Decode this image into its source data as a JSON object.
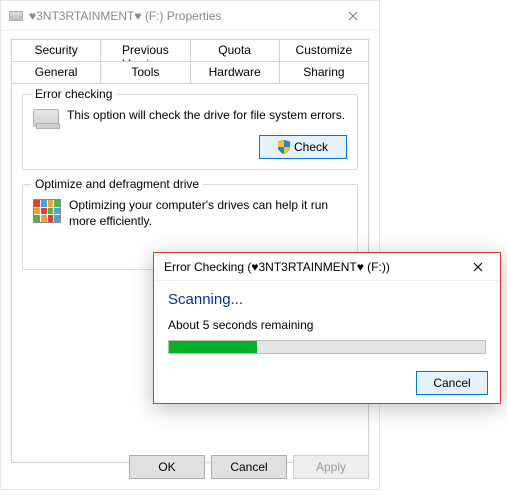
{
  "window": {
    "title": "♥3NT3RTAINMENT♥ (F:) Properties"
  },
  "tabs": {
    "row1": {
      "security": "Security",
      "previous_versions": "Previous Versions",
      "quota": "Quota",
      "customize": "Customize"
    },
    "row2": {
      "general": "General",
      "tools": "Tools",
      "hardware": "Hardware",
      "sharing": "Sharing"
    },
    "active": "tools"
  },
  "error_check_group": {
    "title": "Error checking",
    "desc": "This option will check the drive for file system errors.",
    "button": "Check"
  },
  "defrag_group": {
    "title": "Optimize and defragment drive",
    "desc": "Optimizing your computer's drives can help it run more efficiently."
  },
  "buttons": {
    "ok": "OK",
    "cancel": "Cancel",
    "apply": "Apply"
  },
  "modal": {
    "title": "Error Checking (♥3NT3RTAINMENT♥ (F:))",
    "heading": "Scanning...",
    "remaining": "About 5 seconds remaining",
    "progress_pct": 28,
    "cancel": "Cancel"
  }
}
